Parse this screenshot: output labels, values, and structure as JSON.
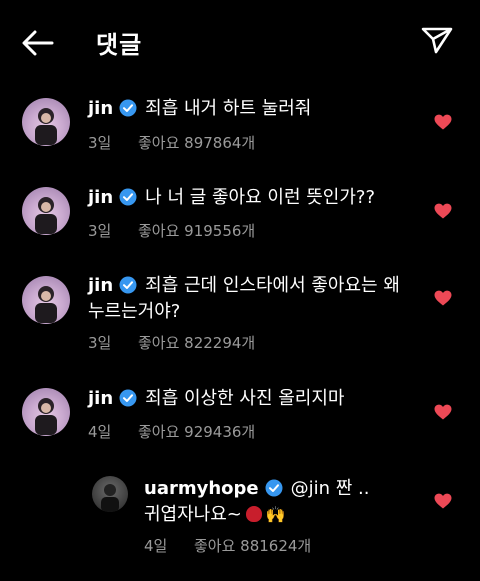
{
  "header": {
    "title": "댓글",
    "back_icon": "arrow-left-icon",
    "send_icon": "paper-plane-icon"
  },
  "colors": {
    "background": "#000000",
    "heart": "#ed4956",
    "verified": "#3797f0",
    "meta": "#9a9a9a"
  },
  "comments": [
    {
      "username": "jin",
      "text_line1": "죄흡 내거 하트 눌러줘",
      "text_line2": "",
      "age": "3일",
      "likes": "좋아요 897864개"
    },
    {
      "username": "jin",
      "text_line1": "나 너 글 좋아요 이런 뜻인가??",
      "text_line2": "",
      "age": "3일",
      "likes": "좋아요 919556개"
    },
    {
      "username": "jin",
      "text_line1": "죄흡 근데 인스타에서 좋아요는 왜",
      "text_line2": "누르는거야?",
      "age": "3일",
      "likes": "좋아요 822294개"
    },
    {
      "username": "jin",
      "text_line1": "죄흡 이상한 사진 올리지마",
      "text_line2": "",
      "age": "4일",
      "likes": "좋아요 929436개"
    }
  ],
  "reply": {
    "username": "uarmyhope",
    "text_line1": "@jin 짠 ..",
    "text_line2": "귀엽자나요~",
    "age": "4일",
    "likes": "좋아요 881624개"
  }
}
